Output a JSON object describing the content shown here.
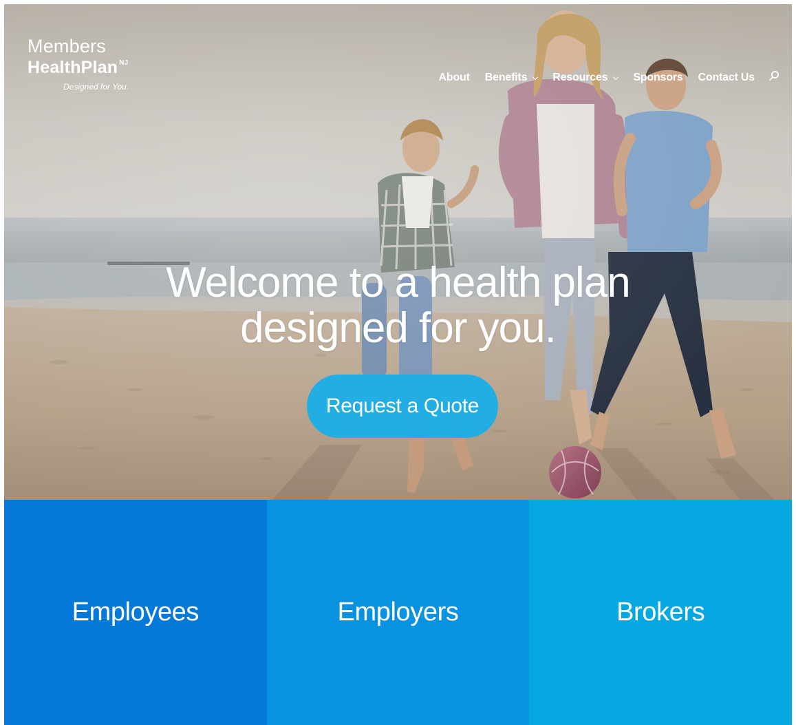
{
  "brand": {
    "line1": "Members",
    "line2": "HealthPlan",
    "superscript": "NJ",
    "tagline": "Designed for You."
  },
  "nav": {
    "items": [
      {
        "label": "About",
        "has_dropdown": false
      },
      {
        "label": "Benefits",
        "has_dropdown": true
      },
      {
        "label": "Resources",
        "has_dropdown": true
      },
      {
        "label": "Sponsors",
        "has_dropdown": false
      },
      {
        "label": "Contact Us",
        "has_dropdown": false
      }
    ],
    "search_icon": "search-icon"
  },
  "hero": {
    "heading_line1": "Welcome to a health plan",
    "heading_line2": "designed for you.",
    "cta_label": "Request a Quote"
  },
  "panels": [
    {
      "label": "Employees",
      "color": "#0579d8"
    },
    {
      "label": "Employers",
      "color": "#0992e0"
    },
    {
      "label": "Brokers",
      "color": "#06a8e2"
    }
  ],
  "colors": {
    "cta": "#23aee3"
  }
}
